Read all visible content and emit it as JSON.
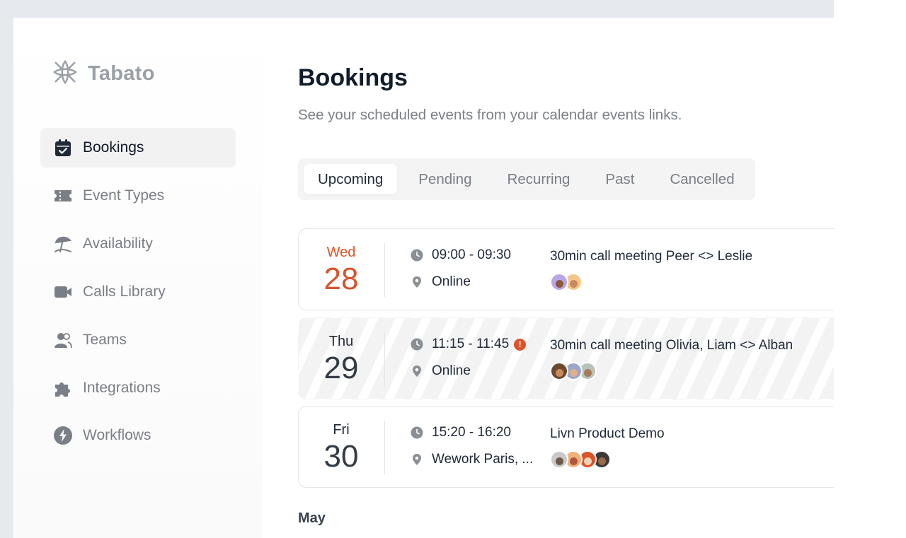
{
  "app": {
    "name": "Tabato"
  },
  "sidebar": {
    "items": [
      {
        "label": "Bookings",
        "icon": "calendar-check-icon",
        "active": true
      },
      {
        "label": "Event Types",
        "icon": "ticket-icon",
        "active": false
      },
      {
        "label": "Availability",
        "icon": "beach-umbrella-icon",
        "active": false
      },
      {
        "label": "Calls Library",
        "icon": "video-camera-icon",
        "active": false
      },
      {
        "label": "Teams",
        "icon": "users-icon",
        "active": false
      },
      {
        "label": "Integrations",
        "icon": "puzzle-icon",
        "active": false
      },
      {
        "label": "Workflows",
        "icon": "lightning-icon",
        "active": false
      }
    ]
  },
  "main": {
    "title": "Bookings",
    "subtitle": "See your scheduled events from your calendar events links.",
    "tabs": [
      {
        "label": "Upcoming",
        "active": true
      },
      {
        "label": "Pending",
        "active": false
      },
      {
        "label": "Recurring",
        "active": false
      },
      {
        "label": "Past",
        "active": false
      },
      {
        "label": "Cancelled",
        "active": false
      }
    ],
    "bookings": [
      {
        "day": "Wed",
        "date": "28",
        "today": true,
        "time": "09:00 - 09:30",
        "location": "Online",
        "title": "30min call meeting Peer <> Leslie",
        "warning": false,
        "attendees": [
          {
            "bg": "#b9a6e8",
            "skin": "#8a5a3c"
          },
          {
            "bg": "#f2c88a",
            "skin": "#c98b5e"
          }
        ]
      },
      {
        "day": "Thu",
        "date": "29",
        "today": false,
        "time": "11:15 - 11:45",
        "location": "Online",
        "title": "30min call meeting Olivia, Liam <> Alban",
        "warning": true,
        "attendees": [
          {
            "bg": "#6b4a2f",
            "skin": "#c98b5e"
          },
          {
            "bg": "#9aa7c9",
            "skin": "#e0b08a"
          },
          {
            "bg": "#b8c2b6",
            "skin": "#a87a5a"
          }
        ]
      },
      {
        "day": "Fri",
        "date": "30",
        "today": false,
        "time": "15:20 - 16:20",
        "location": "Wework Paris, ...",
        "title": "Livn Product Demo",
        "warning": false,
        "attendees": [
          {
            "bg": "#c9c9c9",
            "skin": "#6b5a4a"
          },
          {
            "bg": "#f0b27a",
            "skin": "#b0563a"
          },
          {
            "bg": "#d9532b",
            "skin": "#f1d3b8"
          },
          {
            "bg": "#3a3a3a",
            "skin": "#9a6a4a"
          }
        ]
      }
    ],
    "month_label": "May"
  },
  "colors": {
    "accent": "#d9532b",
    "muted_text": "#7a7f86",
    "active_nav_bg": "#f2f2f3"
  }
}
